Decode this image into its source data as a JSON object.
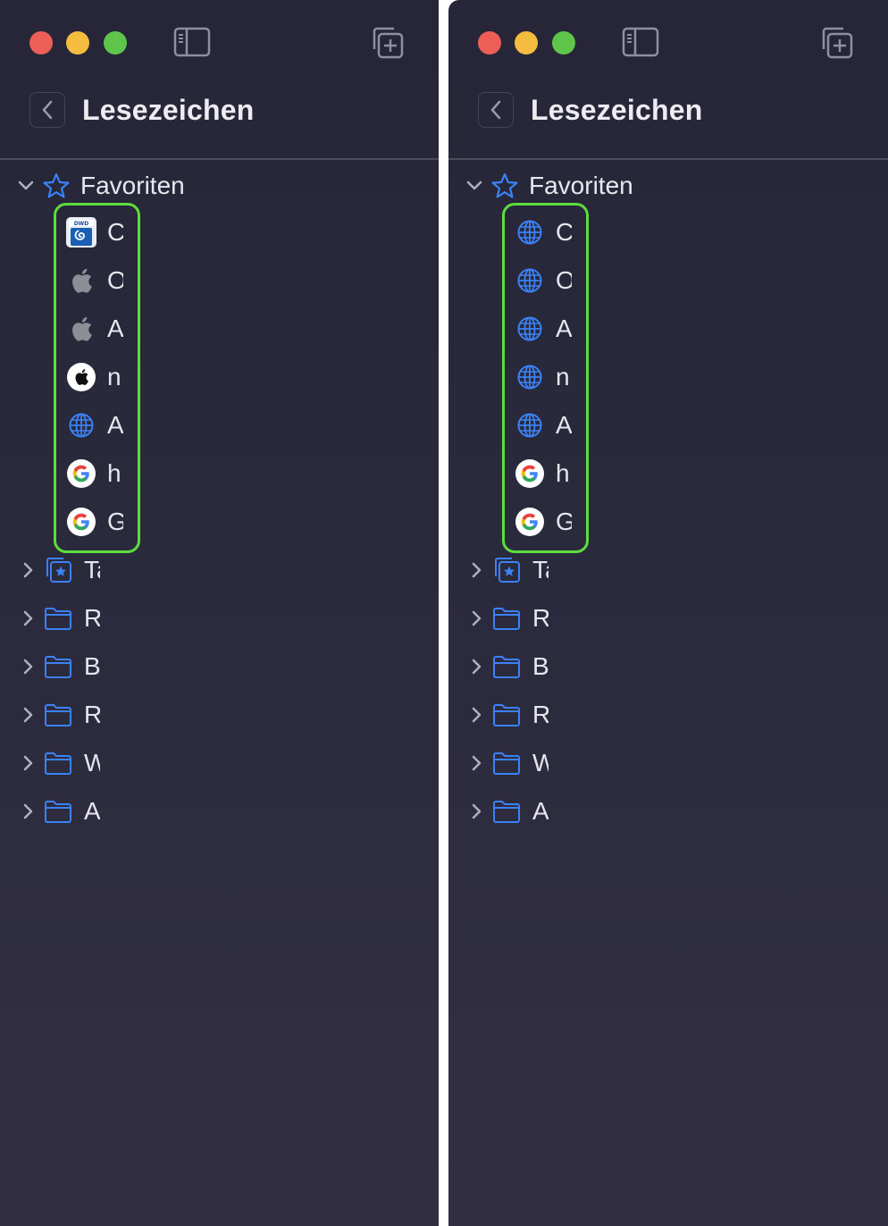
{
  "panels": [
    {
      "title": "Lesezeichen",
      "favorites": {
        "label": "Favoriten",
        "items": [
          {
            "label": "C",
            "icon": "dwd-icon"
          },
          {
            "label": "O",
            "icon": "apple-gray-icon"
          },
          {
            "label": "A",
            "icon": "apple-gray-icon"
          },
          {
            "label": "n",
            "icon": "apple-white-circle-icon"
          },
          {
            "label": "A",
            "icon": "globe-icon"
          },
          {
            "label": "h",
            "icon": "google-icon"
          },
          {
            "label": "G",
            "icon": "google-icon"
          }
        ]
      },
      "folders": [
        {
          "label": "Ta",
          "icon": "tab-group-star-icon"
        },
        {
          "label": "R",
          "icon": "folder-icon"
        },
        {
          "label": "B",
          "icon": "folder-icon"
        },
        {
          "label": "R",
          "icon": "folder-icon"
        },
        {
          "label": "W",
          "icon": "folder-icon"
        },
        {
          "label": "A",
          "icon": "folder-icon"
        }
      ]
    },
    {
      "title": "Lesezeichen",
      "favorites": {
        "label": "Favoriten",
        "items": [
          {
            "label": "C",
            "icon": "globe-icon"
          },
          {
            "label": "O",
            "icon": "globe-icon"
          },
          {
            "label": "A",
            "icon": "globe-icon"
          },
          {
            "label": "n",
            "icon": "globe-icon"
          },
          {
            "label": "A",
            "icon": "globe-icon"
          },
          {
            "label": "h",
            "icon": "google-icon"
          },
          {
            "label": "G",
            "icon": "google-icon"
          }
        ]
      },
      "folders": [
        {
          "label": "Ta",
          "icon": "tab-group-star-icon"
        },
        {
          "label": "R",
          "icon": "folder-icon"
        },
        {
          "label": "B",
          "icon": "folder-icon"
        },
        {
          "label": "R",
          "icon": "folder-icon"
        },
        {
          "label": "W",
          "icon": "folder-icon"
        },
        {
          "label": "A",
          "icon": "folder-icon"
        }
      ]
    }
  ],
  "colors": {
    "accent": "#3b82f6",
    "highlight": "#5cde3c",
    "background": "#2a2a3d",
    "traffic_red": "#ed5f56",
    "traffic_yellow": "#f4bd3f",
    "traffic_green": "#5fc54a"
  }
}
